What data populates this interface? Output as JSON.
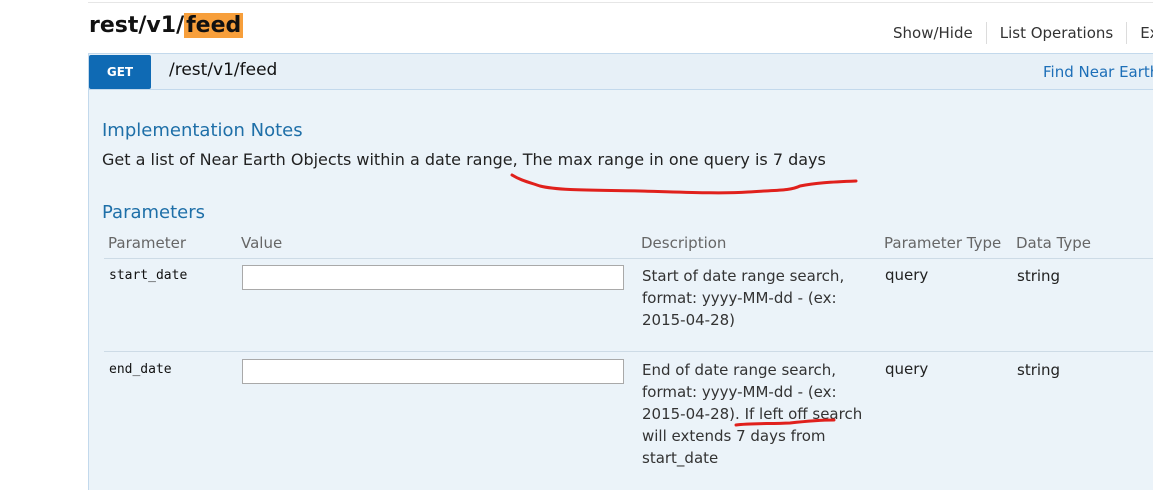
{
  "resource": {
    "prefix": "rest/v1/",
    "highlight": "feed"
  },
  "operations": [
    "Show/Hide",
    "List Operations",
    "Ex"
  ],
  "endpoint": {
    "method": "GET",
    "path": "/rest/v1/feed",
    "summary": "Find Near Earth"
  },
  "implementation_notes": {
    "heading": "Implementation Notes",
    "text": "Get a list of Near Earth Objects within a date range, The max range in one query is 7 days"
  },
  "parameters": {
    "heading": "Parameters",
    "columns": [
      "Parameter",
      "Value",
      "Description",
      "Parameter Type",
      "Data Type"
    ],
    "rows": [
      {
        "name": "start_date",
        "value": "",
        "description": "Start of date range search, format: yyyy-MM-dd - (ex: 2015-04-28)",
        "param_type": "query",
        "data_type": "string"
      },
      {
        "name": "end_date",
        "value": "",
        "description_before": "End of date range search, format: yyyy-MM-dd - (ex: 2015-04-28). ",
        "description_emph": "If left off",
        "description_after": " search will extends 7 days from start_date",
        "param_type": "query",
        "data_type": "string"
      }
    ]
  },
  "colors": {
    "get_button": "#0f6ab4",
    "heading_blue": "#1e6fa8",
    "highlight": "#f79f3b",
    "annotation_red": "#e0201c",
    "panel_bg": "#ebf3f9"
  }
}
